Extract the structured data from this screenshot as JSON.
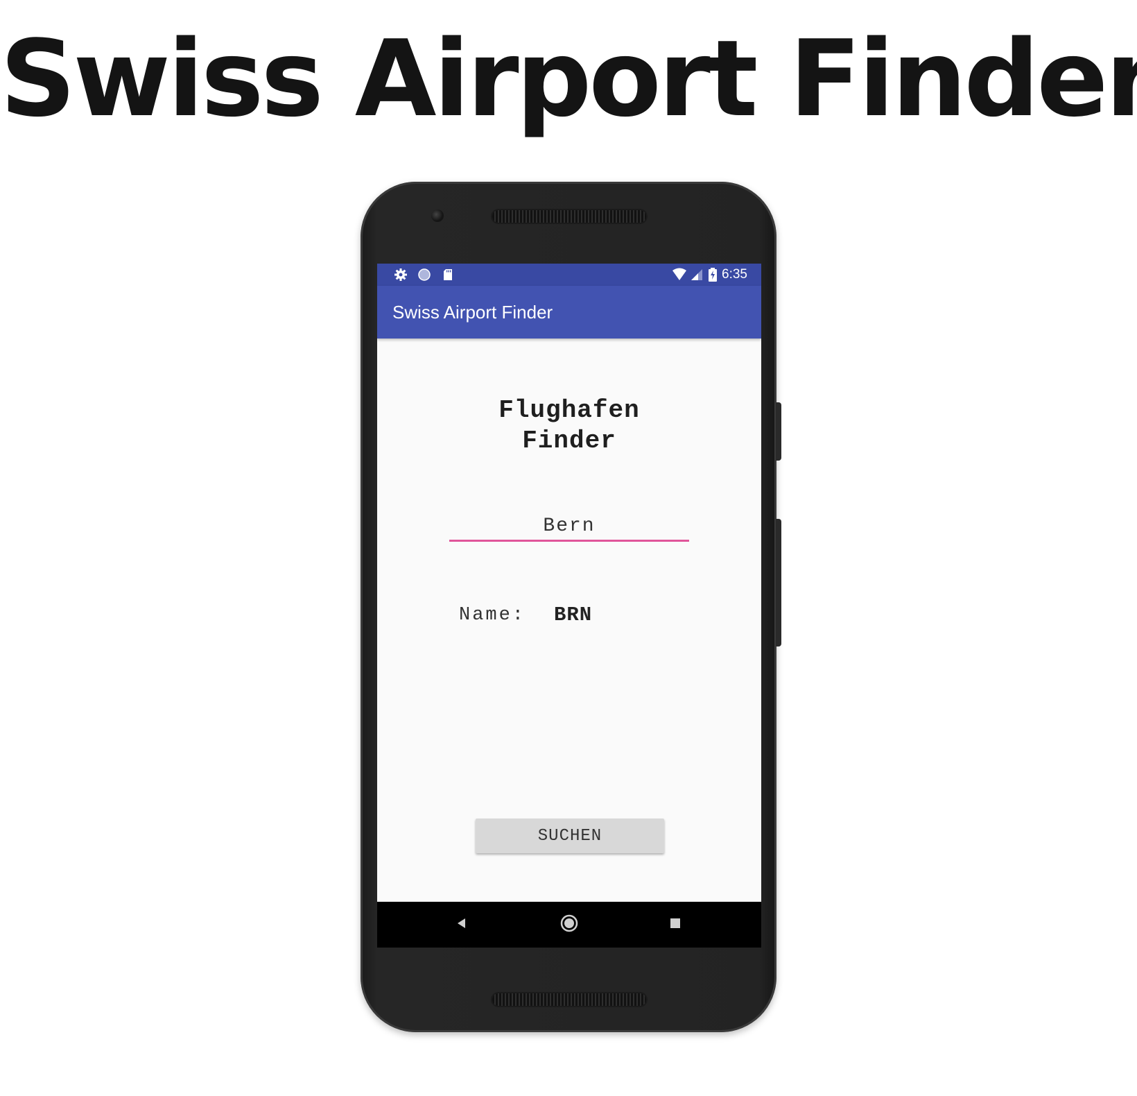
{
  "page": {
    "heading": "Swiss Airport Finder"
  },
  "status_bar": {
    "time": "6:35",
    "left_icons": [
      "settings-icon",
      "sync-circle-icon",
      "sd-card-icon"
    ],
    "right_icons": [
      "wifi-icon",
      "cell-signal-icon",
      "battery-charging-icon"
    ]
  },
  "app_bar": {
    "title": "Swiss Airport Finder",
    "color": "#4253b1",
    "status_color": "#3949a3"
  },
  "main": {
    "heading_line1": "Flughafen",
    "heading_line2": "Finder",
    "city_input_value": "Bern",
    "result_label": "Name:",
    "result_value": "BRN",
    "search_button_label": "SUCHEN",
    "accent_color": "#e0559a"
  },
  "nav_bar": {
    "buttons": [
      "back-icon",
      "home-icon",
      "recents-icon"
    ]
  }
}
